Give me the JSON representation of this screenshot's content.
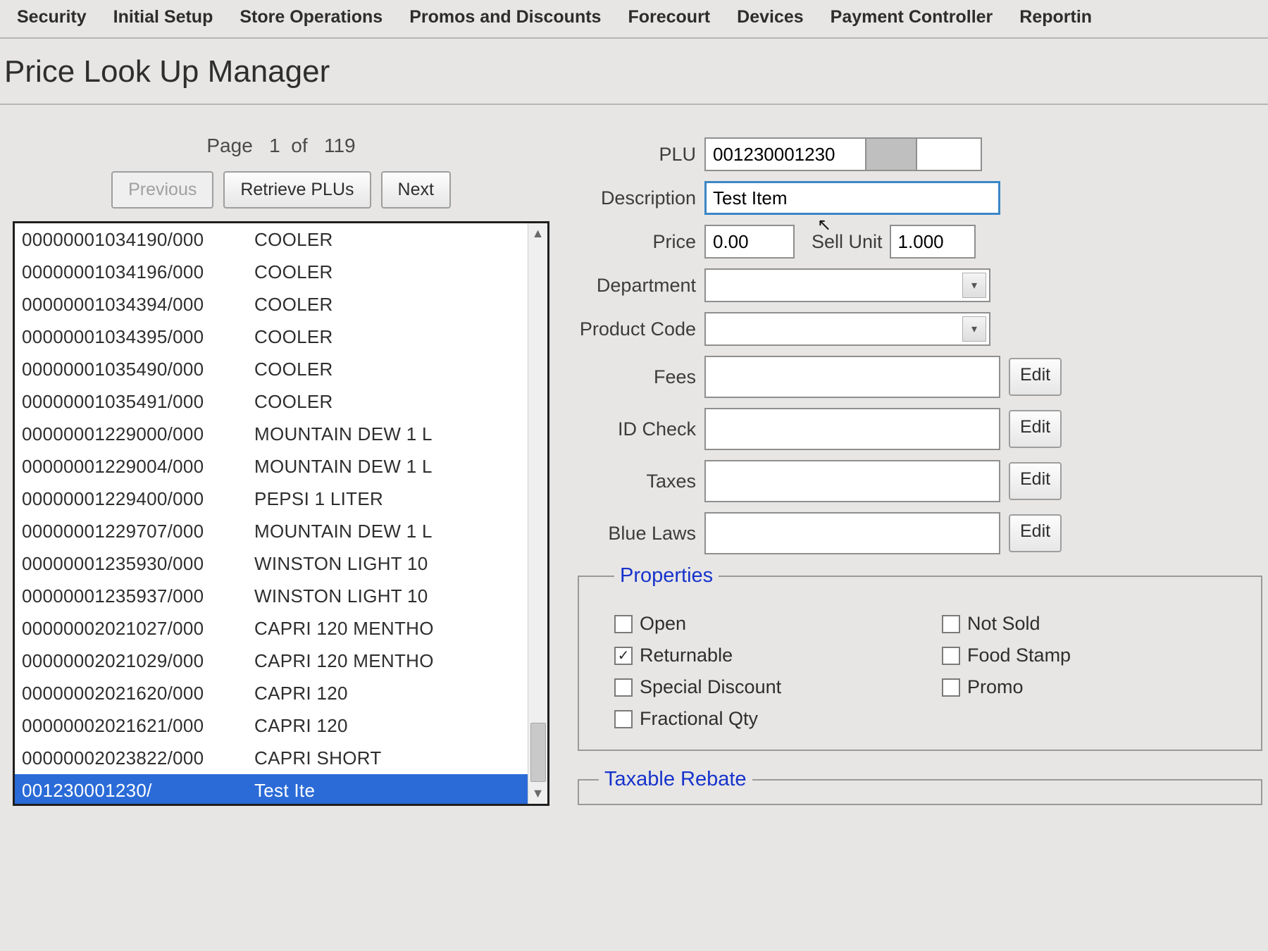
{
  "menu": [
    "Security",
    "Initial Setup",
    "Store Operations",
    "Promos and Discounts",
    "Forecourt",
    "Devices",
    "Payment Controller",
    "Reportin"
  ],
  "title": "Price Look Up Manager",
  "pager": {
    "label_prefix": "Page",
    "current": "1",
    "of_label": "of",
    "total": "119"
  },
  "buttons": {
    "previous": "Previous",
    "retrieve": "Retrieve PLUs",
    "next": "Next",
    "edit": "Edit"
  },
  "list": [
    {
      "plu": "00000001034190/000",
      "desc": "COOLER"
    },
    {
      "plu": "00000001034196/000",
      "desc": "COOLER"
    },
    {
      "plu": "00000001034394/000",
      "desc": "COOLER"
    },
    {
      "plu": "00000001034395/000",
      "desc": "COOLER"
    },
    {
      "plu": "00000001035490/000",
      "desc": "COOLER"
    },
    {
      "plu": "00000001035491/000",
      "desc": "COOLER"
    },
    {
      "plu": "00000001229000/000",
      "desc": "MOUNTAIN DEW 1 L"
    },
    {
      "plu": "00000001229004/000",
      "desc": "MOUNTAIN DEW 1 L"
    },
    {
      "plu": "00000001229400/000",
      "desc": "PEPSI 1 LITER"
    },
    {
      "plu": "00000001229707/000",
      "desc": "MOUNTAIN DEW 1 L"
    },
    {
      "plu": "00000001235930/000",
      "desc": "WINSTON LIGHT 10"
    },
    {
      "plu": "00000001235937/000",
      "desc": "WINSTON LIGHT 10"
    },
    {
      "plu": "00000002021027/000",
      "desc": "CAPRI 120 MENTHO"
    },
    {
      "plu": "00000002021029/000",
      "desc": "CAPRI 120 MENTHO"
    },
    {
      "plu": "00000002021620/000",
      "desc": "CAPRI 120"
    },
    {
      "plu": "00000002021621/000",
      "desc": "CAPRI 120"
    },
    {
      "plu": "00000002023822/000",
      "desc": "CAPRI SHORT"
    },
    {
      "plu": "001230001230/",
      "desc": "Test Ite",
      "selected": true
    }
  ],
  "form": {
    "labels": {
      "plu": "PLU",
      "description": "Description",
      "price": "Price",
      "sell_unit": "Sell Unit",
      "department": "Department",
      "product_code": "Product Code",
      "fees": "Fees",
      "id_check": "ID Check",
      "taxes": "Taxes",
      "blue_laws": "Blue Laws"
    },
    "values": {
      "plu": "001230001230",
      "plu_suffix": "",
      "description": "Test Item",
      "price": "0.00",
      "sell_unit": "1.000",
      "department": "",
      "product_code": "",
      "fees": "",
      "id_check": "",
      "taxes": "",
      "blue_laws": ""
    }
  },
  "properties": {
    "legend": "Properties",
    "items": [
      {
        "label": "Open",
        "checked": false
      },
      {
        "label": "Not Sold",
        "checked": false
      },
      {
        "label": "Returnable",
        "checked": true
      },
      {
        "label": "Food Stamp",
        "checked": false
      },
      {
        "label": "Special Discount",
        "checked": false
      },
      {
        "label": "Promo",
        "checked": false
      },
      {
        "label": "Fractional Qty",
        "checked": false
      }
    ]
  },
  "rebate": {
    "legend": "Taxable Rebate"
  }
}
